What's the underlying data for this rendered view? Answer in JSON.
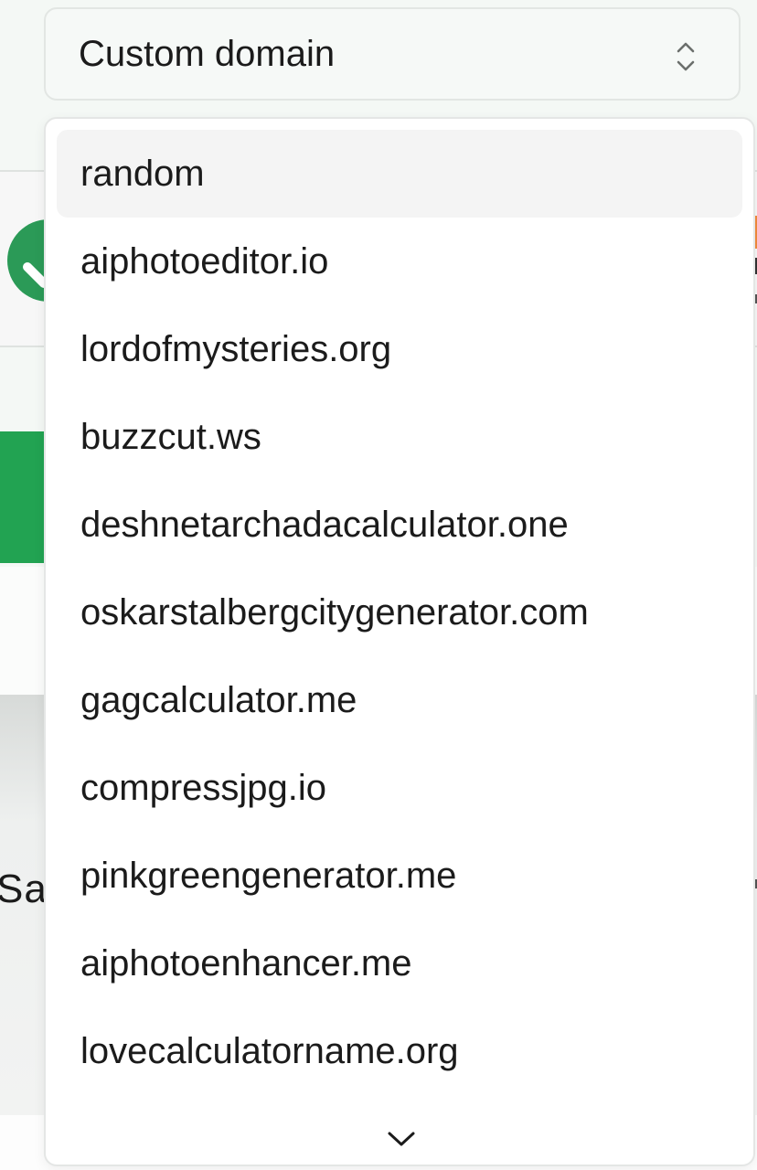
{
  "select": {
    "value": "Custom domain",
    "icon": "chevron-up-down-icon"
  },
  "dropdown": {
    "options": [
      "random",
      "aiphotoeditor.io",
      "lordofmysteries.org",
      "buzzcut.ws",
      "deshnetarchadacalculator.one",
      "oskarstalbergcitygenerator.com",
      "gagcalculator.me",
      "compressjpg.io",
      "pinkgreengenerator.me",
      "aiphotoenhancer.me",
      "lovecalculatorname.org"
    ],
    "highlighted_option": "random",
    "scroll_icon": "chevron-down-icon"
  },
  "background": {
    "partial_text": "Sa",
    "colors": {
      "accent_green": "#22a352",
      "check_green": "#2b9a57"
    }
  }
}
